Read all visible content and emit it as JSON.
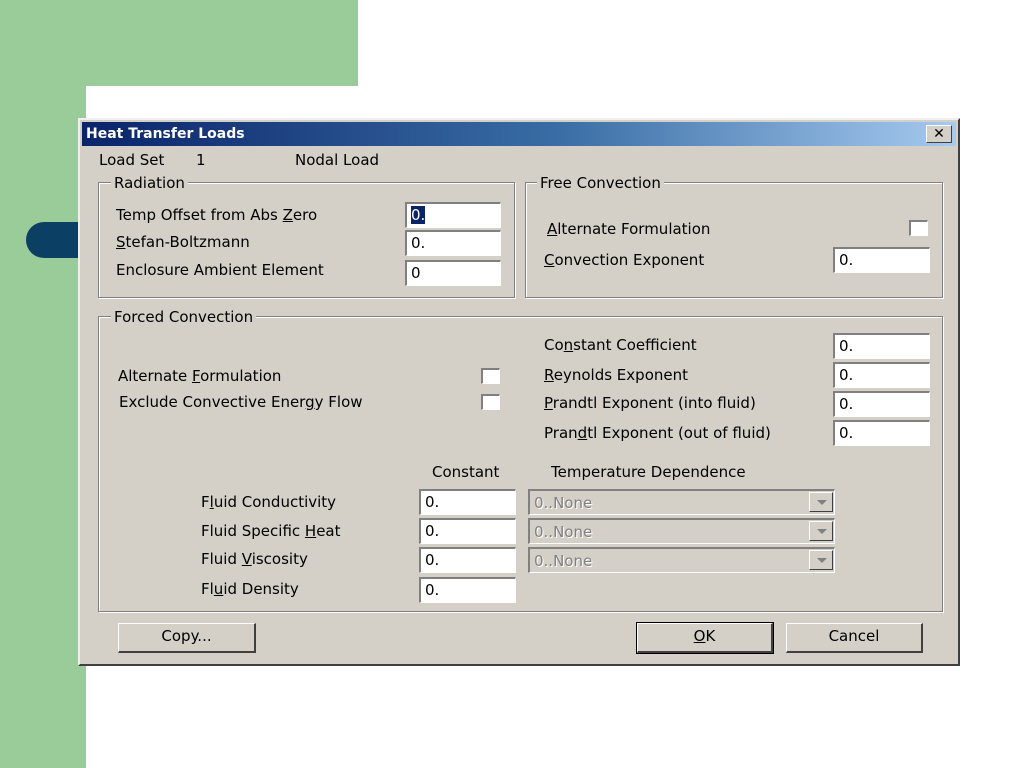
{
  "colors": {
    "slide_green": "#99cc99",
    "slide_navy": "#0b3f63",
    "title_start": "#0a246a",
    "title_end": "#a6caf0",
    "dialog_face": "#d4d0c8"
  },
  "dialog": {
    "title": "Heat Transfer Loads",
    "close_icon": "close-x-icon"
  },
  "load_set": {
    "label": "Load Set",
    "number": "1",
    "type": "Nodal Load"
  },
  "radiation": {
    "legend": "Radiation",
    "temp_offset": {
      "label": "Temp Offset from Abs Zero",
      "access_index": 21,
      "value": "0."
    },
    "stefan_boltzmann": {
      "label": "Stefan-Boltzmann",
      "access_index": 0,
      "value": "0."
    },
    "enclosure": {
      "label": "Enclosure Ambient Element",
      "value": "0"
    }
  },
  "free_convection": {
    "legend": "Free Convection",
    "alternate_formulation": {
      "label": "Alternate Formulation",
      "access_index": 0,
      "checked": false
    },
    "convection_exponent": {
      "label": "Convection Exponent",
      "access_index": 0,
      "value": "0."
    }
  },
  "forced_convection": {
    "legend": "Forced Convection",
    "alternate_formulation": {
      "label": "Alternate Formulation",
      "access_index": 10,
      "checked": false
    },
    "exclude_energy_flow": {
      "label": "Exclude Convective Energy Flow",
      "access_index": 23,
      "checked": false
    },
    "constant_coefficient": {
      "label": "Constant Coefficient",
      "access_index": 2,
      "value": "0."
    },
    "reynolds_exponent": {
      "label": "Reynolds Exponent",
      "access_index": 0,
      "value": "0."
    },
    "prandtl_into": {
      "label": "Prandtl Exponent (into fluid)",
      "access_index": 0,
      "value": "0."
    },
    "prandtl_out": {
      "label": "Prandtl Exponent (out of fluid)",
      "access_index": 4,
      "value": "0."
    },
    "constant_header": "Constant",
    "temp_dependence_header": "Temperature Dependence",
    "properties": [
      {
        "label": "Fluid Conductivity",
        "access_index": 1,
        "value": "0.",
        "dependence": "0..None"
      },
      {
        "label": "Fluid Specific Heat",
        "access_index": 15,
        "value": "0.",
        "dependence": "0..None"
      },
      {
        "label": "Fluid Viscosity",
        "access_index": 6,
        "value": "0.",
        "dependence": "0..None"
      },
      {
        "label": "Fluid Density",
        "access_index": 2,
        "value": "0."
      }
    ]
  },
  "buttons": {
    "copy": "Copy...",
    "ok": "OK",
    "ok_access_index": 0,
    "cancel": "Cancel"
  }
}
